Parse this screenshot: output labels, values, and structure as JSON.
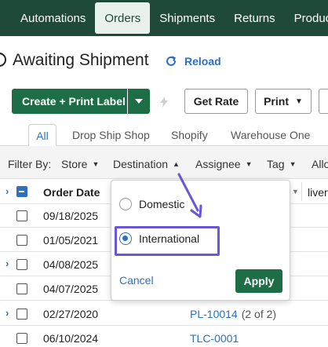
{
  "nav": {
    "items": [
      {
        "label": "Automations",
        "active": false
      },
      {
        "label": "Orders",
        "active": true
      },
      {
        "label": "Shipments",
        "active": false
      },
      {
        "label": "Returns",
        "active": false
      },
      {
        "label": "Products",
        "active": false
      }
    ]
  },
  "page": {
    "title": "Awaiting Shipment",
    "reload_label": "Reload"
  },
  "actions": {
    "create_label": "Create + Print Label",
    "get_rate": "Get Rate",
    "print": "Print"
  },
  "tabs": [
    "All",
    "Drop Ship Shop",
    "Shopify",
    "Warehouse One"
  ],
  "filters": {
    "label": "Filter By:",
    "items": [
      "Store",
      "Destination",
      "Assignee",
      "Tag",
      "Allo"
    ]
  },
  "table": {
    "date_header": "Order Date",
    "live_header": "liver",
    "rows": [
      {
        "date": "09/18/2025",
        "order": "",
        "count": "",
        "expander": false
      },
      {
        "date": "01/05/2021",
        "order": "",
        "count": "",
        "expander": false
      },
      {
        "date": "04/08/2025",
        "order": "",
        "count": "",
        "expander": true
      },
      {
        "date": "04/07/2025",
        "order": "",
        "count": "",
        "expander": false
      },
      {
        "date": "02/27/2020",
        "order": "PL-10014",
        "count": "(2 of 2)",
        "expander": true
      },
      {
        "date": "06/10/2024",
        "order": "TLC-0001",
        "count": "",
        "expander": false
      }
    ]
  },
  "destination_popover": {
    "options": [
      {
        "label": "Domestic",
        "selected": false
      },
      {
        "label": "International",
        "selected": true
      }
    ],
    "cancel": "Cancel",
    "apply": "Apply"
  },
  "colors": {
    "nav_bg": "#1f4a37",
    "primary_green": "#1d6e46",
    "link_blue": "#2d6fc2",
    "annotation_purple": "#6b55d8"
  }
}
